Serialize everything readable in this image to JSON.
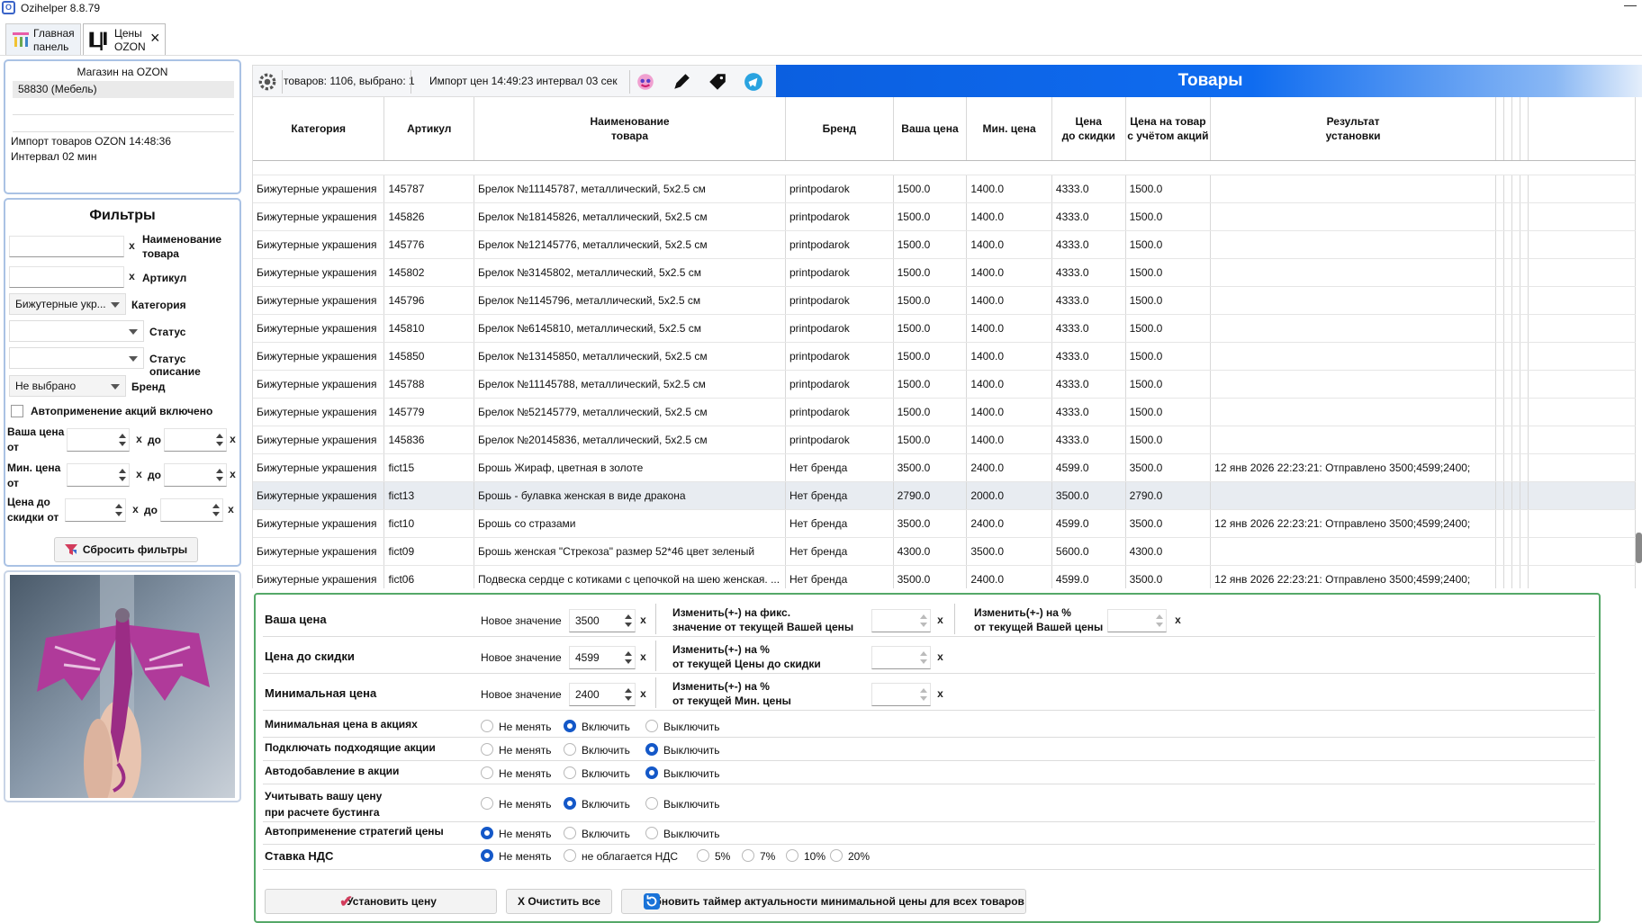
{
  "window": {
    "title": "Ozihelper 8.8.79"
  },
  "tabs": [
    {
      "label_line1": "Главная",
      "label_line2": "панель"
    },
    {
      "label_line1": "Цены",
      "label_line2": "OZON",
      "close": "×"
    }
  ],
  "store": {
    "heading": "Магазин на OZON",
    "selected": "58830 (Мебель)",
    "import_line1": "Импорт товаров OZON 14:48:36",
    "import_line2": "Интервал 02 мин"
  },
  "filters": {
    "title": "Фильтры",
    "name_label_1": "Наименование",
    "name_label_2": "товара",
    "article_label": "Артикул",
    "category_value": "Бижутерные укр...",
    "category_label": "Категория",
    "status_label": "Статус",
    "status_desc_label": "Статус описание",
    "brand_value": "Не выбрано",
    "brand_label": "Бренд",
    "auto_label": "Автоприменение акций включено",
    "price_label_1": "Ваша цена",
    "price_label_2": "от",
    "min_label_1": "Мин. цена",
    "min_label_2": "от",
    "disc_label_1": "Цена до",
    "disc_label_2": "скидки от",
    "to": "до",
    "x": "x",
    "reset_button": "Сбросить фильтры"
  },
  "toolbar": {
    "count": "товаров: 1106, выбрано: 1",
    "import_info": "Импорт цен 14:49:23 интервал 03 сек",
    "banner_title": "Товары"
  },
  "table": {
    "headers": [
      {
        "l1": "Категория",
        "l2": ""
      },
      {
        "l1": "Артикул",
        "l2": ""
      },
      {
        "l1": "Наименование",
        "l2": "товара"
      },
      {
        "l1": "Бренд",
        "l2": ""
      },
      {
        "l1": "Ваша цена",
        "l2": ""
      },
      {
        "l1": "Мин. цена",
        "l2": ""
      },
      {
        "l1": "Цена",
        "l2": "до скидки"
      },
      {
        "l1": "Цена на товар",
        "l2": "с учётом акций"
      },
      {
        "l1": "Результат",
        "l2": "установки"
      }
    ],
    "rows": [
      [
        "Бижутерные украшения",
        "145787",
        "Брелок №11145787, металлический, 5x2.5 см",
        "printpodarok",
        "1500.0",
        "1400.0",
        "4333.0",
        "1500.0",
        ""
      ],
      [
        "Бижутерные украшения",
        "145826",
        "Брелок №18145826, металлический, 5x2.5 см",
        "printpodarok",
        "1500.0",
        "1400.0",
        "4333.0",
        "1500.0",
        ""
      ],
      [
        "Бижутерные украшения",
        "145776",
        "Брелок №12145776, металлический, 5x2.5 см",
        "printpodarok",
        "1500.0",
        "1400.0",
        "4333.0",
        "1500.0",
        ""
      ],
      [
        "Бижутерные украшения",
        "145802",
        "Брелок №3145802, металлический, 5x2.5 см",
        "printpodarok",
        "1500.0",
        "1400.0",
        "4333.0",
        "1500.0",
        ""
      ],
      [
        "Бижутерные украшения",
        "145796",
        "Брелок №1145796, металлический, 5x2.5 см",
        "printpodarok",
        "1500.0",
        "1400.0",
        "4333.0",
        "1500.0",
        ""
      ],
      [
        "Бижутерные украшения",
        "145810",
        "Брелок №6145810, металлический, 5x2.5 см",
        "printpodarok",
        "1500.0",
        "1400.0",
        "4333.0",
        "1500.0",
        ""
      ],
      [
        "Бижутерные украшения",
        "145850",
        "Брелок №13145850, металлический, 5x2.5 см",
        "printpodarok",
        "1500.0",
        "1400.0",
        "4333.0",
        "1500.0",
        ""
      ],
      [
        "Бижутерные украшения",
        "145788",
        "Брелок №11145788, металлический, 5x2.5 см",
        "printpodarok",
        "1500.0",
        "1400.0",
        "4333.0",
        "1500.0",
        ""
      ],
      [
        "Бижутерные украшения",
        "145779",
        "Брелок №52145779, металлический, 5x2.5 см",
        "printpodarok",
        "1500.0",
        "1400.0",
        "4333.0",
        "1500.0",
        ""
      ],
      [
        "Бижутерные украшения",
        "145836",
        "Брелок №20145836, металлический, 5x2.5 см",
        "printpodarok",
        "1500.0",
        "1400.0",
        "4333.0",
        "1500.0",
        ""
      ],
      [
        "Бижутерные украшения",
        "fict15",
        "Брошь Жираф, цветная в золоте",
        "Нет бренда",
        "3500.0",
        "2400.0",
        "4599.0",
        "3500.0",
        "12 янв 2026 22:23:21:  Отправлено 3500;4599;2400;"
      ],
      [
        "Бижутерные украшения",
        "fict13",
        "Брошь - булавка женская в виде дракона",
        "Нет бренда",
        "2790.0",
        "2000.0",
        "3500.0",
        "2790.0",
        ""
      ],
      [
        "Бижутерные украшения",
        "fict10",
        "Брошь со стразами",
        "Нет бренда",
        "3500.0",
        "2400.0",
        "4599.0",
        "3500.0",
        "12 янв 2026 22:23:21:  Отправлено 3500;4599;2400;"
      ],
      [
        "Бижутерные украшения",
        "fict09",
        "Брошь женская \"Стрекоза\" размер 52*46 цвет зеленый",
        "Нет бренда",
        "4300.0",
        "3500.0",
        "5600.0",
        "4300.0",
        ""
      ],
      [
        "Бижутерные украшения",
        "fict06",
        "Подвеска сердце с котиками с цепочкой на шею женская. ...",
        "Нет бренда",
        "3500.0",
        "2400.0",
        "4599.0",
        "3500.0",
        "12 янв 2026 22:23:21:  Отправлено 3500;4599;2400;"
      ]
    ]
  },
  "editor": {
    "price_label": "Ваша цена",
    "discount_label": "Цена до скидки",
    "min_label": "Минимальная цена",
    "new_value": "Новое значение",
    "price_value": "3500",
    "discount_value": "4599",
    "min_value": "2400",
    "change_fix_1": "Изменить(+-) на фикс.",
    "change_fix_2": "значение от текущей Вашей цены",
    "change_pct_1": "Изменить(+-) на %",
    "change_pct_price_2": "от текущей Вашей цены",
    "change_pct_disc_2": "от текущей Цены до скидки",
    "change_pct_min_2": "от текущей Мин. цены",
    "x": "x",
    "options": [
      {
        "label": "Минимальная цена в акциях",
        "selected": 1
      },
      {
        "label": "Подключать подходящие акции",
        "selected": 2
      },
      {
        "label": "Автодобавление в акции",
        "selected": 2
      },
      {
        "label": "Учитывать вашу цену при расчете бустинга",
        "label_1": "Учитывать вашу цену",
        "label_2": "при расчете бустинга",
        "selected": 1
      },
      {
        "label": "Автоприменение стратегий цены",
        "selected": 0
      }
    ],
    "radio_labels": [
      "Не менять",
      "Включить",
      "Выключить"
    ],
    "vat_label": "Ставка НДС",
    "vat_options": [
      "Не менять",
      "не облагается НДС",
      "5%",
      "7%",
      "10%",
      "20%"
    ],
    "set_button": "Установить цену",
    "clear_button": "X Очистить все",
    "refresh_button": "Обновить таймер актуальности минимальной цены для всех товаров"
  },
  "colors": {
    "accent": "#0b5fe0",
    "panel_border": "#aac2e4",
    "editor_border": "#55a868"
  }
}
